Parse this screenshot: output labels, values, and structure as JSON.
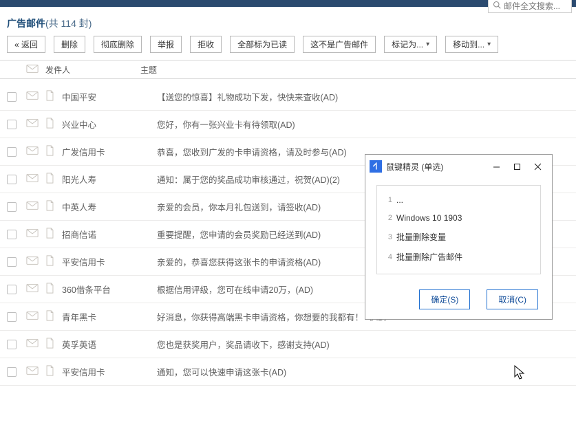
{
  "search": {
    "placeholder": "邮件全文搜索..."
  },
  "header": {
    "title": "广告邮件",
    "count_label": "(共 114 封)"
  },
  "toolbar": {
    "back": "« 返回",
    "delete": "删除",
    "hard_delete": "彻底删除",
    "report": "举报",
    "reject": "拒收",
    "mark_all_read": "全部标为已读",
    "not_ad": "这不是广告邮件",
    "mark_as": "标记为...",
    "move_to": "移动到..."
  },
  "columns": {
    "sender": "发件人",
    "subject": "主题"
  },
  "mails": [
    {
      "sender": "中国平安",
      "subject": "【送您的惊喜】礼物成功下发，快快来查收(AD)"
    },
    {
      "sender": "兴业中心",
      "subject": "您好，你有一张兴业卡有待领取(AD)"
    },
    {
      "sender": "广发信用卡",
      "subject": "恭喜，您收到广发的卡申请资格，请及时参与(AD)"
    },
    {
      "sender": "阳光人寿",
      "subject": "通知：属于您的奖品成功审核通过，祝贺(AD)(2)"
    },
    {
      "sender": "中英人寿",
      "subject": "亲爱的会员，你本月礼包送到，请签收(AD)"
    },
    {
      "sender": "招商信诺",
      "subject": "重要提醒，您申请的会员奖励已经送到(AD)"
    },
    {
      "sender": "平安信用卡",
      "subject": "亲爱的，恭喜您获得这张卡的申请资格(AD)"
    },
    {
      "sender": "360借条平台",
      "subject": "根据信用评级，您可在线申请20万，(AD)"
    },
    {
      "sender": "青年黑卡",
      "subject": "好消息，你获得高端黑卡申请资格，你想要的我都有！（AD）"
    },
    {
      "sender": "英孚英语",
      "subject": "您也是获奖用户，奖品请收下，感谢支持(AD)"
    },
    {
      "sender": "平安信用卡",
      "subject": "通知，您可以快速申请这张卡(AD)"
    }
  ],
  "modal": {
    "title": "鼠键精灵 (单选)",
    "options": [
      {
        "n": "1",
        "label": "..."
      },
      {
        "n": "2",
        "label": "Windows 10 1903"
      },
      {
        "n": "3",
        "label": "批量删除变量"
      },
      {
        "n": "4",
        "label": "批量删除广告邮件"
      }
    ],
    "ok": "确定(S)",
    "cancel": "取消(C)"
  }
}
